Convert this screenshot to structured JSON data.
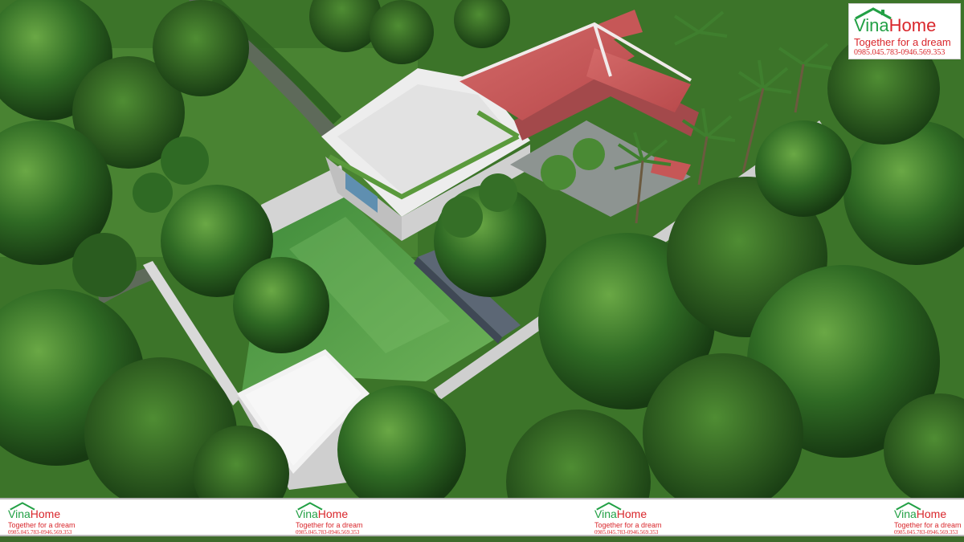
{
  "image": {
    "subject": "aerial-3d-render",
    "colors": {
      "lawn": "#3f7a2c",
      "tree_dark": "#1f4417",
      "tree_mid": "#2e6323",
      "tree_light": "#5b9a3a",
      "pond": "#4f9a45",
      "roof_tile": "#c9595a",
      "flat_roof": "#eeeeee",
      "wall": "#d8d8d8",
      "path": "#5e6a5a"
    }
  },
  "logo": {
    "brand_part1": "Vina",
    "brand_part2": "Home",
    "tagline": "Together for a dream",
    "phone": "0985.045.783-0946.569.353",
    "green": "#22a045",
    "red": "#d9262b",
    "icon": "house-roof-icon"
  },
  "footer": {
    "logos": [
      {
        "brand_part1": "Vina",
        "brand_part2": "Home",
        "tagline": "Together for a dream",
        "phone": "0985.045.783-0946.569.353"
      },
      {
        "brand_part1": "Vina",
        "brand_part2": "Home",
        "tagline": "Together for a dream",
        "phone": "0985.045.783-0946.569.353"
      },
      {
        "brand_part1": "Vina",
        "brand_part2": "Home",
        "tagline": "Together for a dream",
        "phone": "0985.045.783-0946.569.353"
      },
      {
        "brand_part1": "Vina",
        "brand_part2": "Home",
        "tagline": "Together for a dream",
        "phone": "0985.045.783-0946.569.353"
      }
    ]
  }
}
